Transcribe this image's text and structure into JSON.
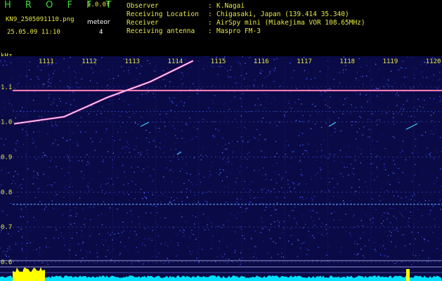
{
  "header": {
    "app_title": "H R O F F T",
    "version": "1.0.0f",
    "filename": "KN9_2505091110.png",
    "datetime": "25.05.09 11:10",
    "mode_label": "meteor",
    "mode_value": "4",
    "info": [
      {
        "key": "Observer",
        "value": "K.Nagai"
      },
      {
        "key": "Receiving Location",
        "value": "Chigasaki, Japan (139.414 35.340)"
      },
      {
        "key": "Receiver",
        "value": "AirSpy mini (Miakejima VOR 108.65MHz)"
      },
      {
        "key": "Receiving antenna",
        "value": "Maspro FM-3"
      }
    ]
  },
  "chart_data": {
    "type": "heatmap",
    "ylabel": "kHz",
    "x_ticks": [
      "1111",
      "1112",
      "1113",
      "1114",
      "1115",
      "1116",
      "1117",
      "1118",
      "1119",
      "1120"
    ],
    "y_ticks": [
      "1.1",
      "1.0",
      "0.9",
      "0.8",
      "0.7",
      "0.6"
    ],
    "ylim": [
      0.59,
      1.18
    ],
    "carrier_khz": 1.09,
    "constant_line_khz": 0.765,
    "drift_trace": {
      "x": [
        "1111",
        "1112",
        "1113",
        "1114",
        "1115"
      ],
      "y": [
        0.995,
        1.015,
        1.07,
        1.115,
        1.175
      ]
    },
    "colors": {
      "background": "#0a0a46",
      "carrier": "#ff60d0",
      "trace": "#ffffff",
      "level": "#00e0ff",
      "peaks": "#ffff00"
    }
  }
}
